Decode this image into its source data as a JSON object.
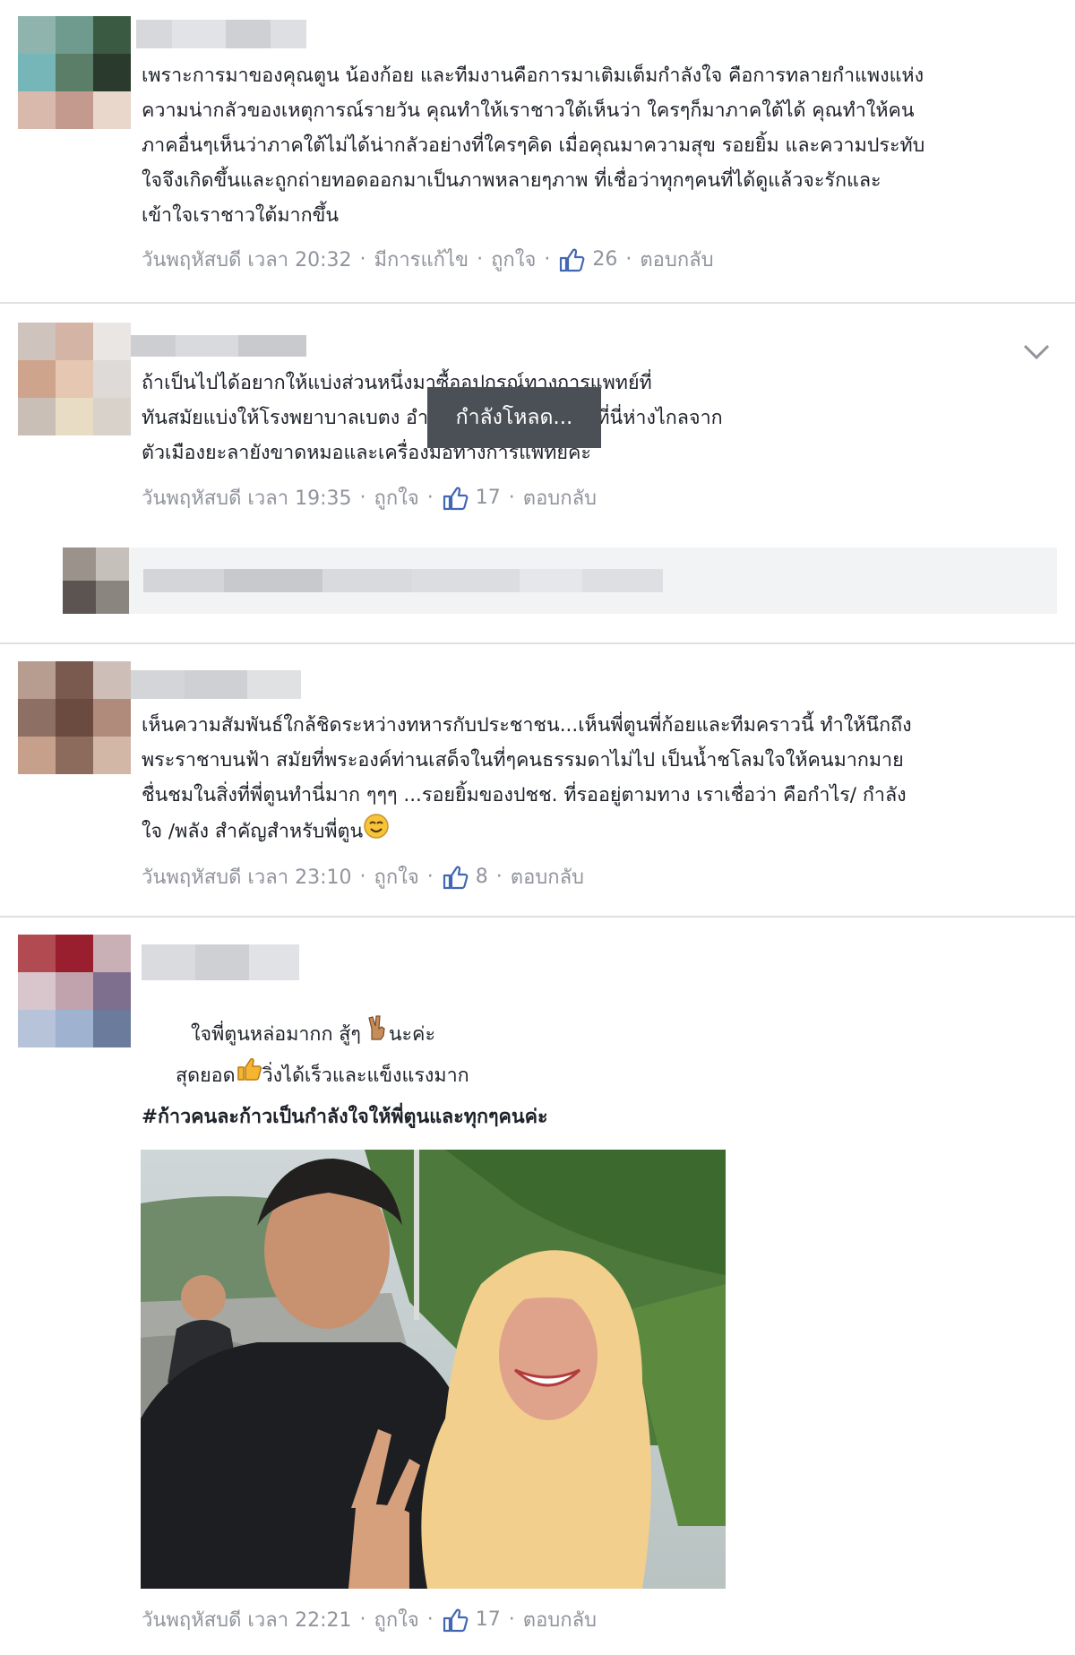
{
  "colors": {
    "meta": "#90949c",
    "like_blue": "#4267b2",
    "divider": "#dddfe2",
    "tooltip_bg": "#4b4f56",
    "reply_bg": "#f2f3f5"
  },
  "tooltip": {
    "text": "กำลังโหลด..."
  },
  "comments": [
    {
      "lines": [
        "เพราะการมาของคุณตูน น้องก้อย และทีมงานคือการมาเติมเต็มกำลังใจ คือการทลายกำแพงแห่ง",
        "ความน่ากลัวของเหตุการณ์รายวัน คุณทำให้เราชาวใต้เห็นว่า ใครๆก็มาภาคใต้ได้ คุณทำให้คน",
        "ภาคอื่นๆเห็นว่าภาคใต้ไม่ได้น่ากลัวอย่างที่ใครๆคิด เมื่อคุณมาความสุข รอยยิ้ม และความประทับ",
        "ใจจึงเกิดขึ้นและถูกถ่ายทอดออกมาเป็นภาพหลายๆภาพ ที่เชื่อว่าทุกๆคนที่ได้ดูแล้วจะรักและ",
        "เข้าใจเราชาวใต้มากขึ้น"
      ],
      "time": "วันพฤหัสบดี เวลา 20:32",
      "edited": "มีการแก้ไข",
      "like_label": "ถูกใจ",
      "like_count": "26",
      "reply_label": "ตอบกลับ"
    },
    {
      "lines": [
        "ถ้าเป็นไปได้อยากให้แบ่งส่วนหนึ่งมาซื้ออุปกรณ์ทางการแพทย์ที่",
        "ทันสมัยแบ่งให้โรงพยาบาลเบตง อำเภอเบตง จ.ยะลา ค่ะที่นี่ห่างไกลจาก",
        "ตัวเมืองยะลายังขาดหมอและเครื่องมือทางการแพทย์ค่ะ"
      ],
      "time": "วันพฤหัสบดี เวลา 19:35",
      "like_label": "ถูกใจ",
      "like_count": "17",
      "reply_label": "ตอบกลับ"
    },
    {
      "lines": [
        "เห็นความสัมพันธ์ใกล้ชิดระหว่างทหารกับประชาชน...เห็นพี่ตูนพี่ก้อยและทีมคราวนี้ ทำให้นึกถึง",
        "พระราชาบนฟ้า สมัยที่พระองค์ท่านเสด็จในที่ๆคนธรรมดาไม่ไป เป็นน้ำชโลมใจให้คนมากมาย",
        "ชื่นชมในสิ่งที่พี่ตูนทำนี่มาก ๆๆๆ ...รอยยิ้มของปชช. ที่รออยู่ตามทาง เราเชื่อว่า คือกำไร/ กำลัง",
        "ใจ /พลัง สำคัญสำหรับพี่ตูน"
      ],
      "time": "วันพฤหัสบดี เวลา 23:10",
      "like_label": "ถูกใจ",
      "like_count": "8",
      "reply_label": "ตอบกลับ"
    },
    {
      "line1_pre": "ใจพี่ตูนหล่อมากก สู้ๆ ",
      "line1_post": "นะค่ะ",
      "line2_pre": "สุดยอด",
      "line2_post": "วิ่งได้เร็วและแข็งแรงมาก",
      "hashtag": "#ก้าวคนละก้าวเป็นกำลังใจให้พี่ตูนและทุกๆคนค่ะ",
      "time": "วันพฤหัสบดี เวลา 22:21",
      "like_label": "ถูกใจ",
      "like_count": "17",
      "reply_label": "ตอบกลับ"
    }
  ]
}
